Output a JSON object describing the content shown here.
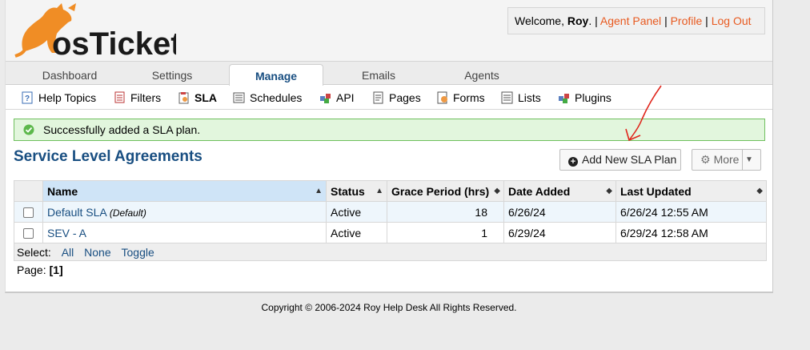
{
  "brand": {
    "logo_text": "osTicket"
  },
  "user": {
    "welcome_prefix": "Welcome,",
    "name": "Roy",
    "welcome_suffix": ". |",
    "agent_panel": "Agent Panel",
    "profile": "Profile",
    "logout": "Log Out",
    "sep": "|"
  },
  "nav": {
    "tabs": [
      {
        "label": "Dashboard"
      },
      {
        "label": "Settings"
      },
      {
        "label": "Manage"
      },
      {
        "label": "Emails"
      },
      {
        "label": "Agents"
      }
    ],
    "active_tab": "Manage"
  },
  "subnav": {
    "items": [
      {
        "label": "Help Topics",
        "icon": "help-topics-icon"
      },
      {
        "label": "Filters",
        "icon": "filters-icon"
      },
      {
        "label": "SLA",
        "icon": "sla-icon"
      },
      {
        "label": "Schedules",
        "icon": "schedules-icon"
      },
      {
        "label": "API",
        "icon": "api-icon"
      },
      {
        "label": "Pages",
        "icon": "pages-icon"
      },
      {
        "label": "Forms",
        "icon": "forms-icon"
      },
      {
        "label": "Lists",
        "icon": "lists-icon"
      },
      {
        "label": "Plugins",
        "icon": "plugins-icon"
      }
    ],
    "active": "SLA"
  },
  "message": {
    "text": "Successfully added a SLA plan."
  },
  "page": {
    "title": "Service Level Agreements",
    "add_button": "Add New SLA Plan",
    "more_button": "More"
  },
  "table": {
    "headers": [
      "Name",
      "Status",
      "Grace Period (hrs)",
      "Date Added",
      "Last Updated"
    ],
    "rows": [
      {
        "name": "Default SLA",
        "tag": "(Default)",
        "status": "Active",
        "grace": "18",
        "added": "6/26/24",
        "updated": "6/26/24 12:55 AM"
      },
      {
        "name": "SEV - A",
        "tag": "",
        "status": "Active",
        "grace": "1",
        "added": "6/29/24",
        "updated": "6/29/24 12:58 AM"
      }
    ],
    "select_label": "Select:",
    "select_all": "All",
    "select_none": "None",
    "select_toggle": "Toggle"
  },
  "pager": {
    "label": "Page:",
    "current": "[1]"
  },
  "footer": {
    "text": "Copyright © 2006-2024 Roy Help Desk All Rights Reserved."
  },
  "colors": {
    "accent": "#184e81",
    "link_orange": "#e85a20",
    "success_bg": "#e2f6dd",
    "success_border": "#6fc05e",
    "annotation": "#e0281e"
  }
}
